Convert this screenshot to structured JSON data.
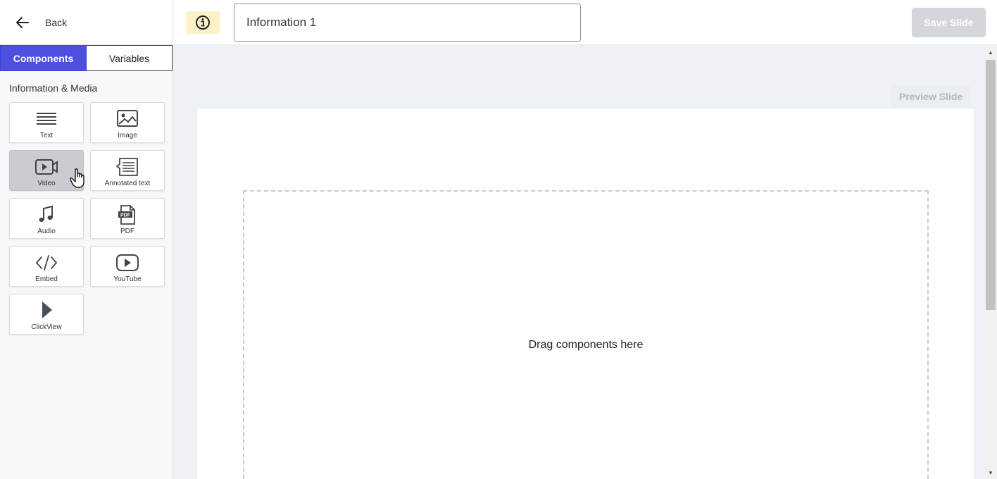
{
  "sidebar": {
    "back_label": "Back",
    "tabs": [
      {
        "label": "Components",
        "active": true
      },
      {
        "label": "Variables",
        "active": false
      }
    ],
    "section_title": "Information & Media",
    "components": [
      {
        "label": "Text",
        "icon": "text-lines-icon"
      },
      {
        "label": "Image",
        "icon": "image-icon"
      },
      {
        "label": "Video",
        "icon": "video-camera-icon",
        "hovered": true
      },
      {
        "label": "Annotated text",
        "icon": "annotated-text-icon"
      },
      {
        "label": "Audio",
        "icon": "music-note-icon"
      },
      {
        "label": "PDF",
        "icon": "pdf-file-icon"
      },
      {
        "label": "Embed",
        "icon": "code-brackets-icon"
      },
      {
        "label": "YouTube",
        "icon": "youtube-play-icon"
      },
      {
        "label": "ClickView",
        "icon": "play-triangle-icon"
      }
    ]
  },
  "header": {
    "info_icon": "info-circle-icon",
    "title_value": "Information 1",
    "save_label": "Save Slide"
  },
  "main": {
    "preview_label": "Preview Slide",
    "dropzone_text": "Drag components here"
  },
  "colors": {
    "accent": "#4c4fe0",
    "info_bg": "#fdf1c7",
    "save_disabled": "#d3d7dc"
  }
}
